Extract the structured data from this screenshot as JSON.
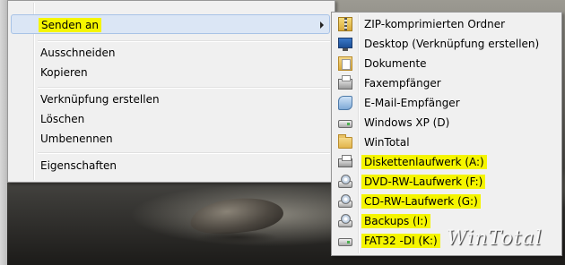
{
  "context_menu": {
    "items": [
      {
        "label": "Senden an",
        "has_submenu": true,
        "highlighted": true
      },
      {
        "label": "Ausschneiden"
      },
      {
        "label": "Kopieren"
      },
      {
        "label": "Verknüpfung erstellen"
      },
      {
        "label": "Löschen"
      },
      {
        "label": "Umbenennen"
      },
      {
        "label": "Eigenschaften"
      }
    ]
  },
  "send_to_submenu": {
    "items": [
      {
        "label": "ZIP-komprimierten Ordner",
        "icon": "zip-folder-icon"
      },
      {
        "label": "Desktop (Verknüpfung erstellen)",
        "icon": "desktop-icon"
      },
      {
        "label": "Dokumente",
        "icon": "documents-icon"
      },
      {
        "label": "Faxempfänger",
        "icon": "fax-icon"
      },
      {
        "label": "E-Mail-Empfänger",
        "icon": "mail-icon"
      },
      {
        "label": "Windows XP (D)",
        "icon": "drive-icon"
      },
      {
        "label": "WinTotal",
        "icon": "folder-icon"
      },
      {
        "label": "Diskettenlaufwerk (A:)",
        "icon": "floppy-drive-icon",
        "highlighted": true
      },
      {
        "label": "DVD-RW-Laufwerk (F:)",
        "icon": "dvd-drive-icon",
        "highlighted": true
      },
      {
        "label": "CD-RW-Laufwerk (G:)",
        "icon": "cd-drive-icon",
        "highlighted": true
      },
      {
        "label": "Backups (I:)",
        "icon": "drive-icon",
        "highlighted": true
      },
      {
        "label": "FAT32 -DI (K:)",
        "icon": "drive-icon",
        "highlighted": true
      }
    ]
  },
  "watermark": "WinTotal",
  "colors": {
    "highlight": "#f5f500",
    "menu_background": "#f0f0f0",
    "selection": "#dbe6f5"
  }
}
